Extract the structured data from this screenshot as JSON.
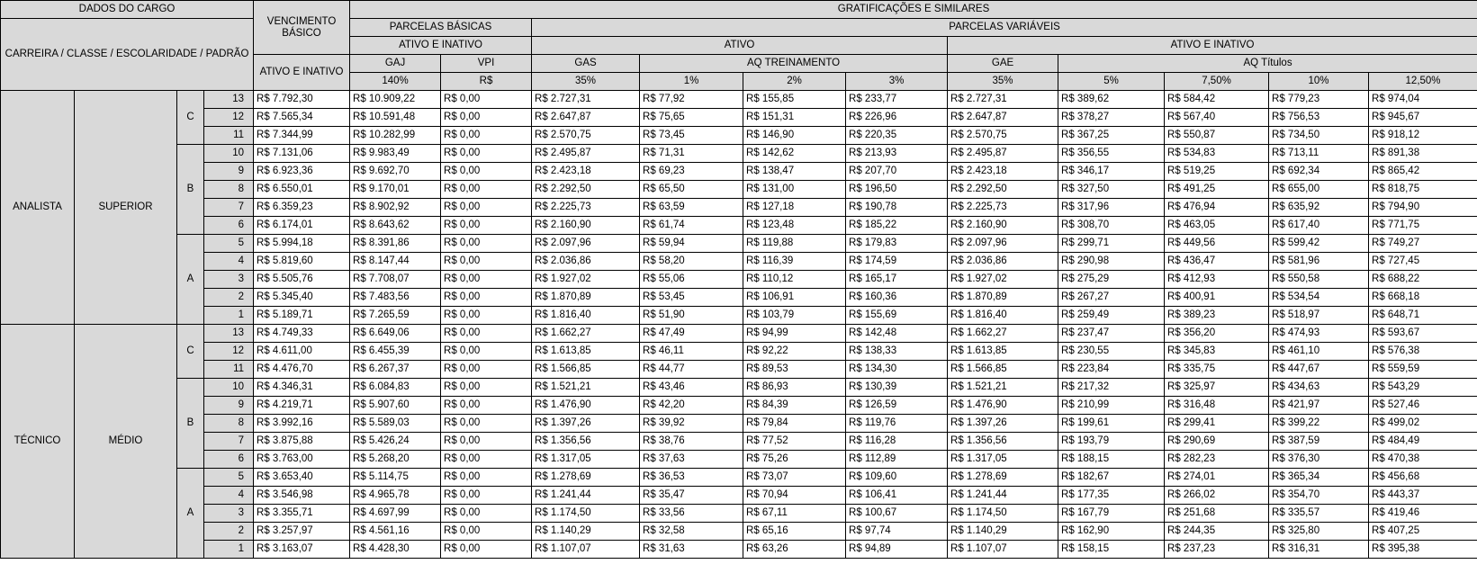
{
  "header": {
    "dados_do_cargo": "DADOS DO CARGO",
    "carreira": "CARREIRA / CLASSE / ESCOLARIDADE / PADRÃO",
    "vencimento_basico": "VENCIMENTO BÁSICO",
    "ativo_e_inativo_vb": "ATIVO E INATIVO",
    "gratificacoes": "GRATIFICAÇÕES E SIMILARES",
    "parcelas_basicas": "PARCELAS BÁSICAS",
    "parcelas_variaveis": "PARCELAS VARIÁVEIS",
    "ativo_e_inativo_pb": "ATIVO E INATIVO",
    "ativo": "ATIVO",
    "ativo_e_inativo_pv": "ATIVO E INATIVO",
    "gaj": "GAJ",
    "vpi": "VPI",
    "gas": "GAS",
    "aq_treinamento": "AQ TREINAMENTO",
    "gae": "GAE",
    "aq_titulos": "AQ  Títulos",
    "pct_gaj": "140%",
    "pct_vpi": "R$",
    "pct_gas": "35%",
    "pct_aqt_1": "1%",
    "pct_aqt_2": "2%",
    "pct_aqt_3": "3%",
    "pct_gae": "35%",
    "pct_aqtit_1": "5%",
    "pct_aqtit_2": "7,50%",
    "pct_aqtit_3": "10%",
    "pct_aqtit_4": "12,50%"
  },
  "careers": [
    {
      "cargo": "ANALISTA",
      "escolaridade": "SUPERIOR",
      "classes": [
        {
          "classe": "C",
          "rows": [
            [
              "13",
              "R$ 7.792,30",
              "R$ 10.909,22",
              "R$ 0,00",
              "R$ 2.727,31",
              "R$ 77,92",
              "R$ 155,85",
              "R$ 233,77",
              "R$ 2.727,31",
              "R$ 389,62",
              "R$ 584,42",
              "R$ 779,23",
              "R$ 974,04"
            ],
            [
              "12",
              "R$ 7.565,34",
              "R$ 10.591,48",
              "R$ 0,00",
              "R$ 2.647,87",
              "R$ 75,65",
              "R$ 151,31",
              "R$ 226,96",
              "R$ 2.647,87",
              "R$ 378,27",
              "R$ 567,40",
              "R$ 756,53",
              "R$ 945,67"
            ],
            [
              "11",
              "R$ 7.344,99",
              "R$ 10.282,99",
              "R$ 0,00",
              "R$ 2.570,75",
              "R$ 73,45",
              "R$ 146,90",
              "R$ 220,35",
              "R$ 2.570,75",
              "R$ 367,25",
              "R$ 550,87",
              "R$ 734,50",
              "R$ 918,12"
            ]
          ]
        },
        {
          "classe": "B",
          "rows": [
            [
              "10",
              "R$ 7.131,06",
              "R$ 9.983,49",
              "R$ 0,00",
              "R$ 2.495,87",
              "R$ 71,31",
              "R$ 142,62",
              "R$ 213,93",
              "R$ 2.495,87",
              "R$ 356,55",
              "R$ 534,83",
              "R$ 713,11",
              "R$ 891,38"
            ],
            [
              "9",
              "R$ 6.923,36",
              "R$ 9.692,70",
              "R$ 0,00",
              "R$ 2.423,18",
              "R$ 69,23",
              "R$ 138,47",
              "R$ 207,70",
              "R$ 2.423,18",
              "R$ 346,17",
              "R$ 519,25",
              "R$ 692,34",
              "R$ 865,42"
            ],
            [
              "8",
              "R$ 6.550,01",
              "R$ 9.170,01",
              "R$ 0,00",
              "R$ 2.292,50",
              "R$ 65,50",
              "R$ 131,00",
              "R$ 196,50",
              "R$ 2.292,50",
              "R$ 327,50",
              "R$ 491,25",
              "R$ 655,00",
              "R$ 818,75"
            ],
            [
              "7",
              "R$ 6.359,23",
              "R$ 8.902,92",
              "R$ 0,00",
              "R$ 2.225,73",
              "R$ 63,59",
              "R$ 127,18",
              "R$ 190,78",
              "R$ 2.225,73",
              "R$ 317,96",
              "R$ 476,94",
              "R$ 635,92",
              "R$ 794,90"
            ],
            [
              "6",
              "R$ 6.174,01",
              "R$ 8.643,62",
              "R$ 0,00",
              "R$ 2.160,90",
              "R$ 61,74",
              "R$ 123,48",
              "R$ 185,22",
              "R$ 2.160,90",
              "R$ 308,70",
              "R$ 463,05",
              "R$ 617,40",
              "R$ 771,75"
            ]
          ]
        },
        {
          "classe": "A",
          "rows": [
            [
              "5",
              "R$ 5.994,18",
              "R$ 8.391,86",
              "R$ 0,00",
              "R$ 2.097,96",
              "R$ 59,94",
              "R$ 119,88",
              "R$ 179,83",
              "R$ 2.097,96",
              "R$ 299,71",
              "R$ 449,56",
              "R$ 599,42",
              "R$ 749,27"
            ],
            [
              "4",
              "R$ 5.819,60",
              "R$ 8.147,44",
              "R$ 0,00",
              "R$ 2.036,86",
              "R$ 58,20",
              "R$ 116,39",
              "R$ 174,59",
              "R$ 2.036,86",
              "R$ 290,98",
              "R$ 436,47",
              "R$ 581,96",
              "R$ 727,45"
            ],
            [
              "3",
              "R$ 5.505,76",
              "R$ 7.708,07",
              "R$ 0,00",
              "R$ 1.927,02",
              "R$ 55,06",
              "R$ 110,12",
              "R$ 165,17",
              "R$ 1.927,02",
              "R$ 275,29",
              "R$ 412,93",
              "R$ 550,58",
              "R$ 688,22"
            ],
            [
              "2",
              "R$ 5.345,40",
              "R$ 7.483,56",
              "R$ 0,00",
              "R$ 1.870,89",
              "R$ 53,45",
              "R$ 106,91",
              "R$ 160,36",
              "R$ 1.870,89",
              "R$ 267,27",
              "R$ 400,91",
              "R$ 534,54",
              "R$ 668,18"
            ],
            [
              "1",
              "R$ 5.189,71",
              "R$ 7.265,59",
              "R$ 0,00",
              "R$ 1.816,40",
              "R$ 51,90",
              "R$ 103,79",
              "R$ 155,69",
              "R$ 1.816,40",
              "R$ 259,49",
              "R$ 389,23",
              "R$ 518,97",
              "R$ 648,71"
            ]
          ]
        }
      ]
    },
    {
      "cargo": "TÉCNICO",
      "escolaridade": "MÉDIO",
      "classes": [
        {
          "classe": "C",
          "rows": [
            [
              "13",
              "R$ 4.749,33",
              "R$ 6.649,06",
              "R$ 0,00",
              "R$ 1.662,27",
              "R$ 47,49",
              "R$ 94,99",
              "R$ 142,48",
              "R$ 1.662,27",
              "R$ 237,47",
              "R$ 356,20",
              "R$ 474,93",
              "R$ 593,67"
            ],
            [
              "12",
              "R$ 4.611,00",
              "R$ 6.455,39",
              "R$ 0,00",
              "R$ 1.613,85",
              "R$ 46,11",
              "R$ 92,22",
              "R$ 138,33",
              "R$ 1.613,85",
              "R$ 230,55",
              "R$ 345,83",
              "R$ 461,10",
              "R$ 576,38"
            ],
            [
              "11",
              "R$ 4.476,70",
              "R$ 6.267,37",
              "R$ 0,00",
              "R$ 1.566,85",
              "R$ 44,77",
              "R$ 89,53",
              "R$ 134,30",
              "R$ 1.566,85",
              "R$ 223,84",
              "R$ 335,75",
              "R$ 447,67",
              "R$ 559,59"
            ]
          ]
        },
        {
          "classe": "B",
          "rows": [
            [
              "10",
              "R$ 4.346,31",
              "R$ 6.084,83",
              "R$ 0,00",
              "R$ 1.521,21",
              "R$ 43,46",
              "R$ 86,93",
              "R$ 130,39",
              "R$ 1.521,21",
              "R$ 217,32",
              "R$ 325,97",
              "R$ 434,63",
              "R$ 543,29"
            ],
            [
              "9",
              "R$ 4.219,71",
              "R$ 5.907,60",
              "R$ 0,00",
              "R$ 1.476,90",
              "R$ 42,20",
              "R$ 84,39",
              "R$ 126,59",
              "R$ 1.476,90",
              "R$ 210,99",
              "R$ 316,48",
              "R$ 421,97",
              "R$ 527,46"
            ],
            [
              "8",
              "R$ 3.992,16",
              "R$ 5.589,03",
              "R$ 0,00",
              "R$ 1.397,26",
              "R$ 39,92",
              "R$ 79,84",
              "R$ 119,76",
              "R$ 1.397,26",
              "R$ 199,61",
              "R$ 299,41",
              "R$ 399,22",
              "R$ 499,02"
            ],
            [
              "7",
              "R$ 3.875,88",
              "R$ 5.426,24",
              "R$ 0,00",
              "R$ 1.356,56",
              "R$ 38,76",
              "R$ 77,52",
              "R$ 116,28",
              "R$ 1.356,56",
              "R$ 193,79",
              "R$ 290,69",
              "R$ 387,59",
              "R$ 484,49"
            ],
            [
              "6",
              "R$ 3.763,00",
              "R$ 5.268,20",
              "R$ 0,00",
              "R$ 1.317,05",
              "R$ 37,63",
              "R$ 75,26",
              "R$ 112,89",
              "R$ 1.317,05",
              "R$ 188,15",
              "R$ 282,23",
              "R$ 376,30",
              "R$ 470,38"
            ]
          ]
        },
        {
          "classe": "A",
          "rows": [
            [
              "5",
              "R$ 3.653,40",
              "R$ 5.114,75",
              "R$ 0,00",
              "R$ 1.278,69",
              "R$ 36,53",
              "R$ 73,07",
              "R$ 109,60",
              "R$ 1.278,69",
              "R$ 182,67",
              "R$ 274,01",
              "R$ 365,34",
              "R$ 456,68"
            ],
            [
              "4",
              "R$ 3.546,98",
              "R$ 4.965,78",
              "R$ 0,00",
              "R$ 1.241,44",
              "R$ 35,47",
              "R$ 70,94",
              "R$ 106,41",
              "R$ 1.241,44",
              "R$ 177,35",
              "R$ 266,02",
              "R$ 354,70",
              "R$ 443,37"
            ],
            [
              "3",
              "R$ 3.355,71",
              "R$ 4.697,99",
              "R$ 0,00",
              "R$ 1.174,50",
              "R$ 33,56",
              "R$ 67,11",
              "R$ 100,67",
              "R$ 1.174,50",
              "R$ 167,79",
              "R$ 251,68",
              "R$ 335,57",
              "R$ 419,46"
            ],
            [
              "2",
              "R$ 3.257,97",
              "R$ 4.561,16",
              "R$ 0,00",
              "R$ 1.140,29",
              "R$ 32,58",
              "R$ 65,16",
              "R$ 97,74",
              "R$ 1.140,29",
              "R$ 162,90",
              "R$ 244,35",
              "R$ 325,80",
              "R$ 407,25"
            ],
            [
              "1",
              "R$ 3.163,07",
              "R$ 4.428,30",
              "R$ 0,00",
              "R$ 1.107,07",
              "R$ 31,63",
              "R$ 63,26",
              "R$ 94,89",
              "R$ 1.107,07",
              "R$ 158,15",
              "R$ 237,23",
              "R$ 316,31",
              "R$ 395,38"
            ]
          ]
        }
      ]
    }
  ]
}
